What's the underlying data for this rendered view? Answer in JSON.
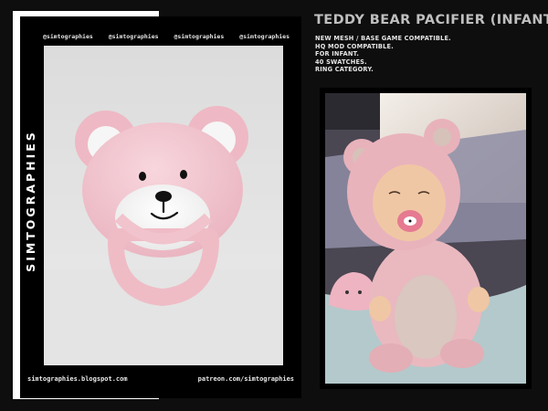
{
  "watermarks": [
    "@simtographies",
    "@simtographies",
    "@simtographies",
    "@simtographies"
  ],
  "brand_vertical": "SIMTOGRAPHIES",
  "footer": {
    "blog": "simtographies.blogspot.com",
    "patreon": "patreon.com/simtographies"
  },
  "title": "TEDDY BEAR PACIFIER (INFANT)",
  "features": [
    "NEW MESH / BASE GAME COMPATIBLE.",
    "HQ MOD COMPATIBLE.",
    "FOR INFANT.",
    "40 SWATCHES.",
    "RING CATEGORY."
  ],
  "colors": {
    "background": "#0e0e0e",
    "pacifier_pink": "#f2c7d0",
    "text_gray": "#bfbfbf"
  }
}
